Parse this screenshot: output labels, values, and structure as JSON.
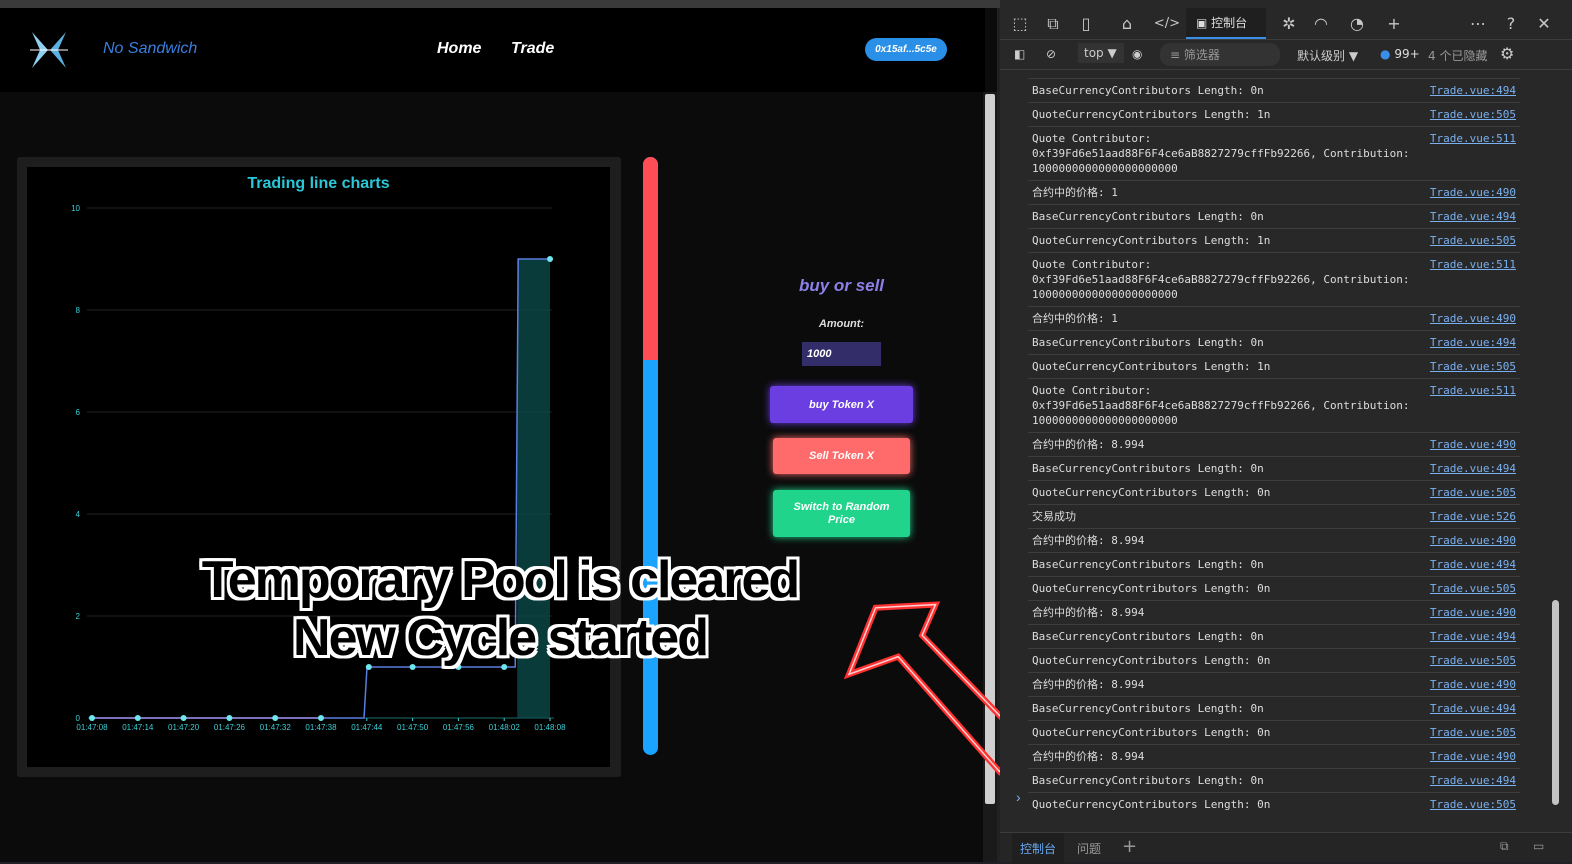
{
  "app": {
    "brand": "No Sandwich",
    "nav": [
      "Home",
      "Trade"
    ],
    "wallet": "0x15af...5c5e"
  },
  "chart_data": {
    "type": "line",
    "title": "Trading line charts",
    "x": [
      "01:47:08",
      "01:47:14",
      "01:47:20",
      "01:47:26",
      "01:47:32",
      "01:47:38",
      "01:47:44",
      "01:47:50",
      "01:47:56",
      "01:48:02",
      "01:48:08"
    ],
    "series": [
      {
        "values": [
          0,
          0,
          0,
          0,
          0,
          0,
          1,
          1,
          1,
          1,
          9
        ]
      }
    ],
    "y_ticks": [
      0,
      2,
      4,
      6,
      8,
      10
    ],
    "ylim": [
      0,
      10
    ],
    "grid": true,
    "colors": {
      "line": "#5a7de0",
      "point": "#6ee6ee",
      "fill": "#0b4a4a",
      "baseline": "#e05050"
    }
  },
  "balance": {
    "red_fraction": 0.34,
    "colors": {
      "red": "#ff4d55",
      "blue": "#1aa3ff"
    }
  },
  "trade": {
    "heading": "buy or sell",
    "amount_label": "Amount:",
    "amount_value": "1000",
    "buy": "buy Token X",
    "sell": "Sell Token X",
    "random": "Switch to Random Price"
  },
  "caption": {
    "line1": "Temporary Pool is cleared",
    "line2": "New Cycle started"
  },
  "devtools": {
    "console_tab": "控制台",
    "context": "top",
    "filter_placeholder": "筛选器",
    "level": "默认级别",
    "count": "99+",
    "hidden": "4 个已隐藏",
    "bottom_tabs": [
      "控制台",
      "问题"
    ],
    "rows": [
      {
        "msg": "BaseCurrencyContributors Length: 0n",
        "link": "Trade.vue:494"
      },
      {
        "msg": "QuoteCurrencyContributors Length: 1n",
        "link": "Trade.vue:505"
      },
      {
        "msg": "Quote Contributor:\n0xf39Fd6e51aad88F6F4ce6aB8827279cffFb92266, Contribution:\n1000000000000000000000",
        "link": "Trade.vue:511"
      },
      {
        "msg": "合约中的价格: 1",
        "link": "Trade.vue:490"
      },
      {
        "msg": "BaseCurrencyContributors Length: 0n",
        "link": "Trade.vue:494"
      },
      {
        "msg": "QuoteCurrencyContributors Length: 1n",
        "link": "Trade.vue:505"
      },
      {
        "msg": "Quote Contributor:\n0xf39Fd6e51aad88F6F4ce6aB8827279cffFb92266, Contribution:\n1000000000000000000000",
        "link": "Trade.vue:511"
      },
      {
        "msg": "合约中的价格: 1",
        "link": "Trade.vue:490"
      },
      {
        "msg": "BaseCurrencyContributors Length: 0n",
        "link": "Trade.vue:494"
      },
      {
        "msg": "QuoteCurrencyContributors Length: 1n",
        "link": "Trade.vue:505"
      },
      {
        "msg": "Quote Contributor:\n0xf39Fd6e51aad88F6F4ce6aB8827279cffFb92266, Contribution:\n1000000000000000000000",
        "link": "Trade.vue:511"
      },
      {
        "msg": "合约中的价格: 8.994",
        "link": "Trade.vue:490"
      },
      {
        "msg": "BaseCurrencyContributors Length: 0n",
        "link": "Trade.vue:494"
      },
      {
        "msg": "QuoteCurrencyContributors Length: 0n",
        "link": "Trade.vue:505"
      },
      {
        "msg": "交易成功",
        "link": "Trade.vue:526"
      },
      {
        "msg": "合约中的价格: 8.994",
        "link": "Trade.vue:490"
      },
      {
        "msg": "BaseCurrencyContributors Length: 0n",
        "link": "Trade.vue:494"
      },
      {
        "msg": "QuoteCurrencyContributors Length: 0n",
        "link": "Trade.vue:505"
      },
      {
        "msg": "合约中的价格: 8.994",
        "link": "Trade.vue:490"
      },
      {
        "msg": "BaseCurrencyContributors Length: 0n",
        "link": "Trade.vue:494"
      },
      {
        "msg": "QuoteCurrencyContributors Length: 0n",
        "link": "Trade.vue:505"
      },
      {
        "msg": "合约中的价格: 8.994",
        "link": "Trade.vue:490"
      },
      {
        "msg": "BaseCurrencyContributors Length: 0n",
        "link": "Trade.vue:494"
      },
      {
        "msg": "QuoteCurrencyContributors Length: 0n",
        "link": "Trade.vue:505"
      },
      {
        "msg": "合约中的价格: 8.994",
        "link": "Trade.vue:490"
      },
      {
        "msg": "BaseCurrencyContributors Length: 0n",
        "link": "Trade.vue:494"
      },
      {
        "msg": "QuoteCurrencyContributors Length: 0n",
        "link": "Trade.vue:505"
      }
    ]
  }
}
